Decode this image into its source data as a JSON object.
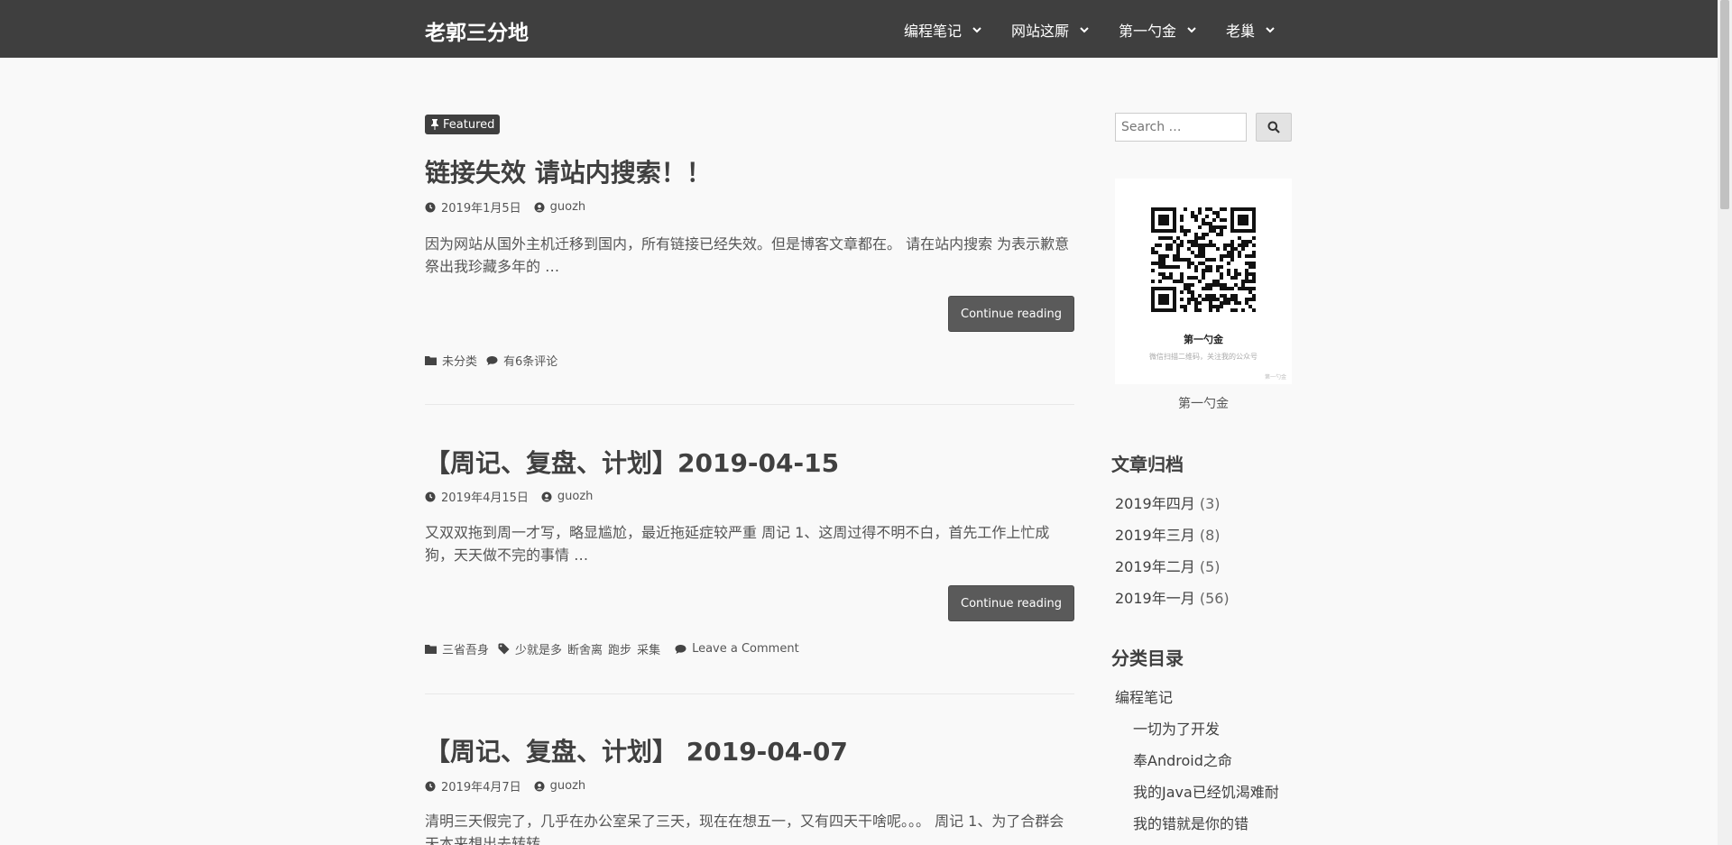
{
  "header": {
    "site_title": "老郭三分地",
    "nav": [
      "编程笔记",
      "网站这厮",
      "第一勺金",
      "老巢"
    ]
  },
  "posts": [
    {
      "badge": "Featured",
      "title": "链接失效 请站内搜索！！",
      "date": "2019年1月5日",
      "author": "guozh",
      "excerpt": "因为网站从国外主机迁移到国内，所有链接已经失效。但是博客文章都在。 请在站内搜索 为表示歉意祭出我珍藏多年的 …",
      "button": "Continue reading",
      "category": "未分类",
      "tags": [],
      "comments": "有6条评论"
    },
    {
      "title": "【周记、复盘、计划】2019-04-15",
      "date": "2019年4月15日",
      "author": "guozh",
      "excerpt": "又双双拖到周一才写，略显尴尬，最近拖延症较严重 周记 1、这周过得不明不白，首先工作上忙成狗，天天做不完的事情 …",
      "button": "Continue reading",
      "category": "三省吾身",
      "tags": [
        "少就是多",
        "断舍离",
        "跑步",
        "采集"
      ],
      "comments": "Leave a Comment"
    },
    {
      "title": "【周记、复盘、计划】 2019-04-07",
      "date": "2019年4月7日",
      "author": "guozh",
      "excerpt": "清明三天假完了，几乎在办公室呆了三天，现在在想五一，又有四天干啥呢。。。 周记 1、为了合群会天本来想出去转转 …"
    }
  ],
  "sidebar": {
    "search_placeholder": "Search …",
    "qr": {
      "name": "第一勺金",
      "hint": "微信扫描二维码，关注我的公众号",
      "mark": "第一勺金"
    },
    "qr_caption": "第一勺金",
    "archive_title": "文章归档",
    "archives": [
      {
        "label": "2019年四月",
        "count": "(3)"
      },
      {
        "label": "2019年三月",
        "count": "(8)"
      },
      {
        "label": "2019年二月",
        "count": "(5)"
      },
      {
        "label": "2019年一月",
        "count": "(56)"
      }
    ],
    "category_title": "分类目录",
    "categories": [
      {
        "label": "编程笔记",
        "level": 0
      },
      {
        "label": "一切为了开发",
        "level": 1
      },
      {
        "label": "奉Android之命",
        "level": 1
      },
      {
        "label": "我的Java已经饥渴难耐",
        "level": 1
      },
      {
        "label": "我的错就是你的错",
        "level": 1
      }
    ]
  },
  "colors": {
    "header_bg": "#3f3f3f",
    "button_bg": "#5a5a5a",
    "page_bg": "#f9f9f9"
  }
}
